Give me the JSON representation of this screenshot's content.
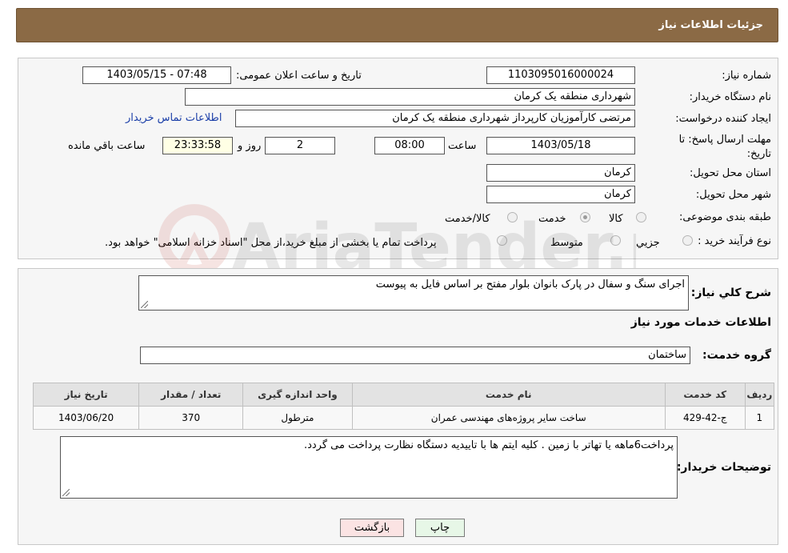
{
  "header": {
    "title": "جزئیات اطلاعات نیاز"
  },
  "form": {
    "need_number": {
      "label": "شماره نیاز:",
      "value": "1103095016000024"
    },
    "announce_datetime": {
      "label": "تاریخ و ساعت اعلان عمومی:",
      "value": "1403/05/15 - 07:48"
    },
    "buyer_org": {
      "label": "نام دستگاه خریدار:",
      "value": "شهرداری منطقه یک کرمان"
    },
    "requester": {
      "label": "ایجاد کننده درخواست:",
      "value": "مرتضی کارآموزیان کارپرداز شهرداری منطقه یک کرمان",
      "contact_link": "اطلاعات تماس خریدار"
    },
    "deadline": {
      "label": "مهلت ارسال پاسخ: تا تاریخ:",
      "date": "1403/05/18",
      "time_label": "ساعت",
      "time": "08:00",
      "days": "2",
      "days_label": "روز و",
      "remaining": "23:33:58",
      "remaining_label": "ساعت باقي مانده"
    },
    "province": {
      "label": "استان محل تحویل:",
      "value": "کرمان"
    },
    "city": {
      "label": "شهر محل تحویل:",
      "value": "کرمان"
    },
    "category": {
      "label": "طبقه بندی موضوعی:",
      "options": [
        {
          "label": "کالا",
          "checked": false
        },
        {
          "label": "خدمت",
          "checked": true
        },
        {
          "label": "کالا/خدمت",
          "checked": false
        }
      ]
    },
    "purchase_type": {
      "label": "نوع فرآیند خرید :",
      "options": [
        {
          "label": "جزیي",
          "checked": false
        },
        {
          "label": "متوسط",
          "checked": false
        }
      ],
      "note": "پرداخت تمام یا بخشی از مبلغ خرید،از محل \"اسناد خزانه اسلامی\" خواهد بود."
    }
  },
  "details": {
    "summary_label": "شرح کلي نياز:",
    "summary_value": "اجرای سنگ و سفال در پارک بانوان بلوار مفتح بر اساس فایل به پیوست",
    "services_title": "اطلاعات خدمات مورد نیاز",
    "service_group_label": "گروه خدمت:",
    "service_group_value": "ساختمان",
    "table": {
      "headers": [
        "ردیف",
        "کد خدمت",
        "نام خدمت",
        "واحد اندازه گیری",
        "تعداد / مقدار",
        "تاریخ نیاز"
      ],
      "rows": [
        [
          "1",
          "ج-42-429",
          "ساخت سایر پروژه‌های مهندسی عمران",
          "مترطول",
          "370",
          "1403/06/20"
        ]
      ]
    },
    "buyer_notes_label": "توضیحات خریدار:",
    "buyer_notes_value": "پرداخت6ماهه یا تهاتر با زمین . کلیه ایتم ها با تاییدیه دستگاه نظارت پرداخت می گردد."
  },
  "buttons": {
    "print": "چاپ",
    "back": "بازگشت"
  },
  "watermark": {
    "text": "AriaTender.neT"
  }
}
